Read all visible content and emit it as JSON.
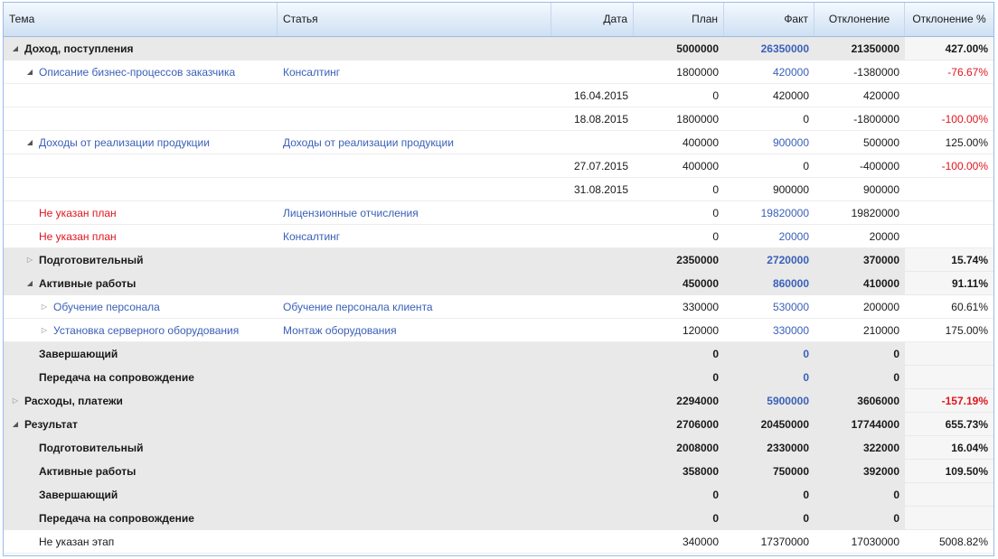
{
  "columns": {
    "topic": "Тема",
    "article": "Статья",
    "date": "Дата",
    "plan": "План",
    "fact": "Факт",
    "deviation": "Отклонение",
    "deviation_pct": "Отклонение %"
  },
  "rows": [
    {
      "level": 0,
      "type": "group",
      "toggle": "expanded",
      "topic": "Доход, поступления",
      "article": "",
      "date": "",
      "plan": "5000000",
      "fact": "26350000",
      "deviation": "21350000",
      "pct": "427.00%",
      "fact_link": true,
      "pct_red": false
    },
    {
      "level": 1,
      "type": "item",
      "toggle": "expanded",
      "topic": "Описание бизнес-процессов заказчика",
      "topic_color": "link",
      "article": "Консалтинг",
      "date": "",
      "plan": "1800000",
      "fact": "420000",
      "deviation": "-1380000",
      "pct": "-76.67%",
      "fact_link": true,
      "pct_red": true
    },
    {
      "level": 2,
      "type": "item",
      "toggle": "none",
      "topic": "",
      "article": "",
      "date": "16.04.2015",
      "plan": "0",
      "fact": "420000",
      "deviation": "420000",
      "pct": "",
      "fact_link": false,
      "pct_red": false
    },
    {
      "level": 2,
      "type": "item",
      "toggle": "none",
      "topic": "",
      "article": "",
      "date": "18.08.2015",
      "plan": "1800000",
      "fact": "0",
      "deviation": "-1800000",
      "pct": "-100.00%",
      "fact_link": false,
      "pct_red": true
    },
    {
      "level": 1,
      "type": "item",
      "toggle": "expanded",
      "topic": "Доходы от реализации продукции",
      "topic_color": "link",
      "article": "Доходы от реализации продукции",
      "date": "",
      "plan": "400000",
      "fact": "900000",
      "deviation": "500000",
      "pct": "125.00%",
      "fact_link": true,
      "pct_red": false
    },
    {
      "level": 2,
      "type": "item",
      "toggle": "none",
      "topic": "",
      "article": "",
      "date": "27.07.2015",
      "plan": "400000",
      "fact": "0",
      "deviation": "-400000",
      "pct": "-100.00%",
      "fact_link": false,
      "pct_red": true
    },
    {
      "level": 2,
      "type": "item",
      "toggle": "none",
      "topic": "",
      "article": "",
      "date": "31.08.2015",
      "plan": "0",
      "fact": "900000",
      "deviation": "900000",
      "pct": "",
      "fact_link": false,
      "pct_red": false
    },
    {
      "level": 1,
      "type": "item",
      "toggle": "none",
      "topic": "Не указан план",
      "topic_color": "red",
      "article": "Лицензионные отчисления",
      "date": "",
      "plan": "0",
      "fact": "19820000",
      "deviation": "19820000",
      "pct": "",
      "fact_link": true,
      "pct_red": false
    },
    {
      "level": 1,
      "type": "item",
      "toggle": "none",
      "topic": "Не указан план",
      "topic_color": "red",
      "article": "Консалтинг",
      "date": "",
      "plan": "0",
      "fact": "20000",
      "deviation": "20000",
      "pct": "",
      "fact_link": true,
      "pct_red": false
    },
    {
      "level": 1,
      "type": "group",
      "toggle": "collapsed",
      "topic": "Подготовительный",
      "article": "",
      "date": "",
      "plan": "2350000",
      "fact": "2720000",
      "deviation": "370000",
      "pct": "15.74%",
      "fact_link": true,
      "pct_red": false
    },
    {
      "level": 1,
      "type": "group",
      "toggle": "expanded",
      "topic": "Активные работы",
      "article": "",
      "date": "",
      "plan": "450000",
      "fact": "860000",
      "deviation": "410000",
      "pct": "91.11%",
      "fact_link": true,
      "pct_red": false
    },
    {
      "level": 2,
      "type": "item",
      "toggle": "collapsed",
      "topic": "Обучение персонала",
      "topic_color": "link",
      "article": "Обучение персонала клиента",
      "date": "",
      "plan": "330000",
      "fact": "530000",
      "deviation": "200000",
      "pct": "60.61%",
      "fact_link": true,
      "pct_red": false
    },
    {
      "level": 2,
      "type": "item",
      "toggle": "collapsed",
      "topic": "Установка серверного оборудования",
      "topic_color": "link",
      "article": "Монтаж оборудования",
      "date": "",
      "plan": "120000",
      "fact": "330000",
      "deviation": "210000",
      "pct": "175.00%",
      "fact_link": true,
      "pct_red": false
    },
    {
      "level": 1,
      "type": "group",
      "toggle": "none",
      "topic": "Завершающий",
      "article": "",
      "date": "",
      "plan": "0",
      "fact": "0",
      "deviation": "0",
      "pct": "",
      "fact_link": true,
      "pct_red": false
    },
    {
      "level": 1,
      "type": "group",
      "toggle": "none",
      "topic": "Передача на сопровождение",
      "article": "",
      "date": "",
      "plan": "0",
      "fact": "0",
      "deviation": "0",
      "pct": "",
      "fact_link": true,
      "pct_red": false
    },
    {
      "level": 0,
      "type": "group",
      "toggle": "collapsed",
      "topic": "Расходы, платежи",
      "article": "",
      "date": "",
      "plan": "2294000",
      "fact": "5900000",
      "deviation": "3606000",
      "pct": "-157.19%",
      "fact_link": true,
      "pct_red": true
    },
    {
      "level": 0,
      "type": "group",
      "toggle": "expanded",
      "topic": "Результат",
      "article": "",
      "date": "",
      "plan": "2706000",
      "fact": "20450000",
      "deviation": "17744000",
      "pct": "655.73%",
      "fact_link": false,
      "pct_red": false
    },
    {
      "level": 1,
      "type": "group",
      "toggle": "none",
      "topic": "Подготовительный",
      "article": "",
      "date": "",
      "plan": "2008000",
      "fact": "2330000",
      "deviation": "322000",
      "pct": "16.04%",
      "fact_link": false,
      "pct_red": false
    },
    {
      "level": 1,
      "type": "group",
      "toggle": "none",
      "topic": "Активные работы",
      "article": "",
      "date": "",
      "plan": "358000",
      "fact": "750000",
      "deviation": "392000",
      "pct": "109.50%",
      "fact_link": false,
      "pct_red": false
    },
    {
      "level": 1,
      "type": "group",
      "toggle": "none",
      "topic": "Завершающий",
      "article": "",
      "date": "",
      "plan": "0",
      "fact": "0",
      "deviation": "0",
      "pct": "",
      "fact_link": false,
      "pct_red": false
    },
    {
      "level": 1,
      "type": "group",
      "toggle": "none",
      "topic": "Передача на сопровождение",
      "article": "",
      "date": "",
      "plan": "0",
      "fact": "0",
      "deviation": "0",
      "pct": "",
      "fact_link": false,
      "pct_red": false
    },
    {
      "level": 1,
      "type": "item",
      "toggle": "none",
      "topic": "Не указан этап",
      "topic_color": "plain",
      "article": "",
      "date": "",
      "plan": "340000",
      "fact": "17370000",
      "deviation": "17030000",
      "pct": "5008.82%",
      "fact_link": false,
      "pct_red": false
    }
  ],
  "colors": {
    "link": "#3a60b8",
    "negative": "#e0151e",
    "group_bg": "#e9e9e9",
    "header_border": "#99bbe8"
  },
  "icons": {
    "expanded": "triangle-down-icon",
    "collapsed": "triangle-right-icon"
  }
}
